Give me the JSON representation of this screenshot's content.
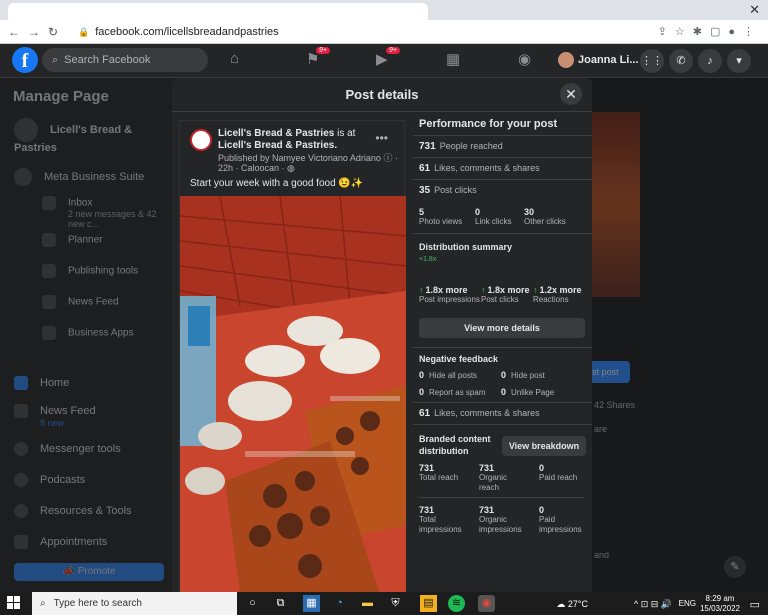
{
  "browser": {
    "url": "facebook.com/licellsbreadandpastries",
    "close_glyph": "✕"
  },
  "fb": {
    "logo": "f",
    "search_placeholder": "Search Facebook",
    "badges": [
      "9+",
      "9+"
    ],
    "user_name": "Joanna Li..."
  },
  "sidebar": {
    "title": "Manage Page",
    "page_name": "Licell's Bread & Pastries",
    "items": [
      {
        "label": "Meta Business Suite"
      },
      {
        "label": "Inbox",
        "sub": "2 new messages & 42 new c..."
      },
      {
        "label": "Planner"
      },
      {
        "label": "Publishing tools"
      },
      {
        "label": "News Feed"
      },
      {
        "label": "Business Apps"
      },
      {
        "label": "Home"
      },
      {
        "label": "News Feed",
        "sub": "8 new"
      },
      {
        "label": "Messenger tools"
      },
      {
        "label": "Podcasts"
      },
      {
        "label": "Resources & Tools"
      },
      {
        "label": "Appointments"
      }
    ],
    "promote": "Promote"
  },
  "modal": {
    "title": "Post details",
    "post": {
      "page": "Licell's Bread & Pastries",
      "is_at": " is at ",
      "location": "Licell's Bread & Pastries.",
      "published": "Published by Namyee Victoriano Adriano",
      "time": "22h · Caloocan · ",
      "text": "Start your week with a good food 😉✨"
    },
    "performance": {
      "title": "Performance for your post",
      "reached": {
        "value": "731",
        "label": "People reached"
      },
      "engagement": {
        "value": "61",
        "label": "Likes, comments & shares"
      },
      "clicks": {
        "value": "35",
        "label": "Post clicks"
      },
      "click_breakdown": [
        {
          "value": "5",
          "label": "Photo views"
        },
        {
          "value": "0",
          "label": "Link clicks"
        },
        {
          "value": "30",
          "label": "Other clicks"
        }
      ],
      "distribution_title": "Distribution summary",
      "distribution_delta": "+1.8x",
      "distribution": [
        {
          "value": "1.8x more",
          "label": "Post impressions"
        },
        {
          "value": "1.8x more",
          "label": "Post clicks"
        },
        {
          "value": "1.2x more",
          "label": "Reactions"
        }
      ],
      "view_more": "View more details",
      "negative_title": "Negative feedback",
      "negative": [
        {
          "value": "0",
          "label": "Hide all posts"
        },
        {
          "value": "0",
          "label": "Hide post"
        },
        {
          "value": "0",
          "label": "Report as spam"
        },
        {
          "value": "0",
          "label": "Unlike Page"
        }
      ],
      "engagement2": {
        "value": "61",
        "label": "Likes, comments & shares"
      },
      "branded_title_1": "Branded content",
      "branded_title_2": "distribution",
      "view_breakdown": "View breakdown",
      "reach": [
        {
          "value": "731",
          "label": "Total reach"
        },
        {
          "value": "731",
          "label": "Organic reach"
        },
        {
          "value": "0",
          "label": "Paid reach"
        }
      ],
      "impressions": [
        {
          "value": "731",
          "label": "Total impressions"
        },
        {
          "value": "731",
          "label": "Organic impressions"
        },
        {
          "value": "0",
          "label": "Paid impressions"
        }
      ]
    }
  },
  "background": {
    "shares": "42 Shares",
    "post_btn": "st post",
    "right_text_1": "are",
    "right_text_2": "and"
  },
  "taskbar": {
    "search_placeholder": "Type here to search",
    "weather": "27°C",
    "lang": "ENG",
    "time": "8:29 am",
    "date": "15/03/2022"
  }
}
